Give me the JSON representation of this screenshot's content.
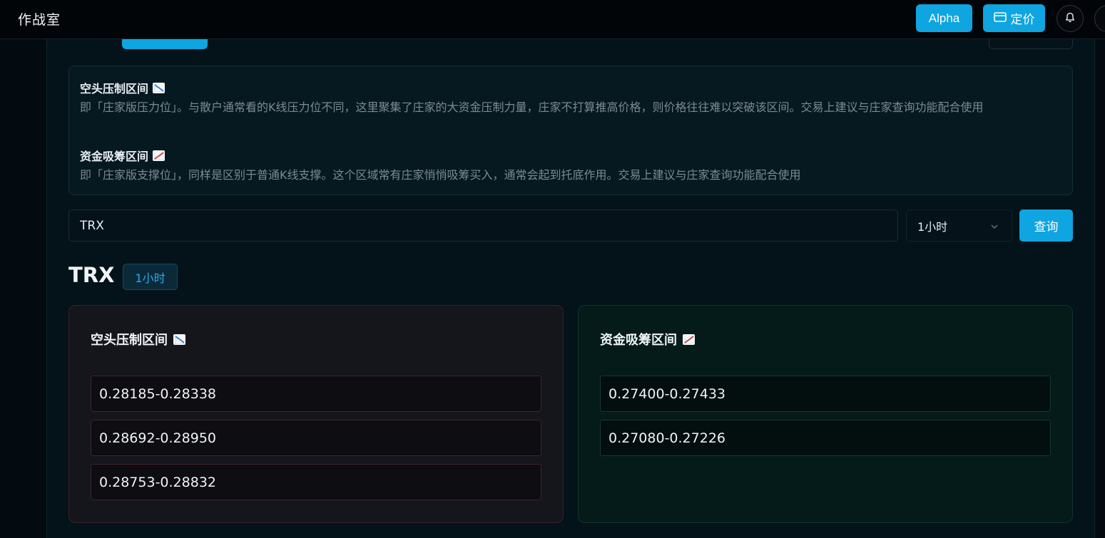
{
  "header": {
    "brand": "作战室",
    "alpha_label": "Alpha",
    "pricing_label": "定价"
  },
  "info": {
    "resistance_title": "空头压制区间",
    "resistance_desc": "即「庄家版压力位」。与散户通常看的K线压力位不同，这里聚集了庄家的大资金压制力量，庄家不打算推高价格，则价格往往难以突破该区间。交易上建议与庄家查询功能配合使用",
    "support_title": "资金吸筹区间",
    "support_desc": "即「庄家版支撑位」，同样是区别于普通K线支撑。这个区域常有庄家悄悄吸筹买入，通常会起到托底作用。交易上建议与庄家查询功能配合使用"
  },
  "query": {
    "symbol_value": "TRX",
    "interval_value": "1小时",
    "query_label": "查询"
  },
  "result": {
    "symbol": "TRX",
    "interval": "1小时",
    "resistance": {
      "title": "空头压制区间",
      "ranges": [
        "0.28185-0.28338",
        "0.28692-0.28950",
        "0.28753-0.28832"
      ]
    },
    "support": {
      "title": "资金吸筹区间",
      "ranges": [
        "0.27400-0.27433",
        "0.27080-0.27226"
      ]
    }
  },
  "icons": {
    "down_chart": "chart-decreasing-icon",
    "up_chart": "chart-increasing-icon",
    "bell": "bell-icon",
    "card": "credit-card-icon",
    "chevron": "chevron-down-icon"
  },
  "colors": {
    "accent": "#0ea5e0",
    "down": "#2f7fd6",
    "up": "#d93a3a"
  }
}
